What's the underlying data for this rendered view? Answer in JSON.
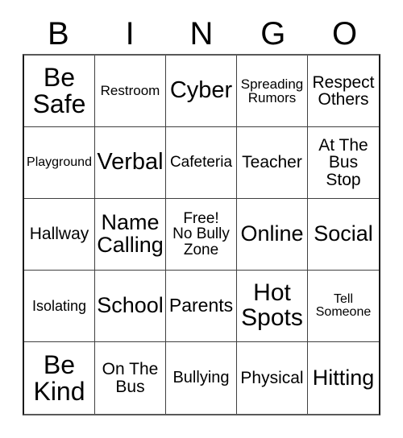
{
  "card": {
    "type": "bingo-card",
    "theme": "Anti-Bullying / School Safety",
    "grid_size": "5x5",
    "free_space_index": 12,
    "text_color": "#000000",
    "background_color": "#ffffff",
    "border_color": "#404040"
  },
  "header": {
    "letters": [
      "B",
      "I",
      "N",
      "G",
      "O"
    ]
  },
  "columns": {
    "B": [
      "Be\nSafe",
      "Playground",
      "Hallway",
      "Isolating",
      "Be\nKind"
    ],
    "I": [
      "Restroom",
      "Verbal",
      "Name\nCalling",
      "School",
      "On The\nBus"
    ],
    "N": [
      "Cyber",
      "Cafeteria",
      "Free!\nNo Bully\nZone",
      "Parents",
      "Bullying"
    ],
    "G": [
      "Spreading\nRumors",
      "Teacher",
      "Online",
      "Hot\nSpots",
      "Physical"
    ],
    "O": [
      "Respect\nOthers",
      "At The\nBus\nStop",
      "Social",
      "Tell\nSomeone",
      "Hitting"
    ]
  },
  "cells": [
    {
      "text": "Be\nSafe",
      "row": 1,
      "col": "B",
      "font_size": 32,
      "free": false
    },
    {
      "text": "Restroom",
      "row": 1,
      "col": "I",
      "font_size": 17,
      "free": false
    },
    {
      "text": "Cyber",
      "row": 1,
      "col": "N",
      "font_size": 29,
      "free": false
    },
    {
      "text": "Spreading\nRumors",
      "row": 1,
      "col": "G",
      "font_size": 17,
      "free": false
    },
    {
      "text": "Respect\nOthers",
      "row": 1,
      "col": "O",
      "font_size": 21,
      "free": false
    },
    {
      "text": "Playground",
      "row": 2,
      "col": "B",
      "font_size": 16,
      "free": false
    },
    {
      "text": "Verbal",
      "row": 2,
      "col": "I",
      "font_size": 29,
      "free": false
    },
    {
      "text": "Cafeteria",
      "row": 2,
      "col": "N",
      "font_size": 19,
      "free": false
    },
    {
      "text": "Teacher",
      "row": 2,
      "col": "G",
      "font_size": 21,
      "free": false
    },
    {
      "text": "At The\nBus\nStop",
      "row": 2,
      "col": "O",
      "font_size": 21,
      "free": false
    },
    {
      "text": "Hallway",
      "row": 3,
      "col": "B",
      "font_size": 21,
      "free": false
    },
    {
      "text": "Name\nCalling",
      "row": 3,
      "col": "I",
      "font_size": 27,
      "free": false
    },
    {
      "text": "Free!\nNo Bully\nZone",
      "row": 3,
      "col": "N",
      "font_size": 19,
      "free": true
    },
    {
      "text": "Online",
      "row": 3,
      "col": "G",
      "font_size": 27,
      "free": false
    },
    {
      "text": "Social",
      "row": 3,
      "col": "O",
      "font_size": 27,
      "free": false
    },
    {
      "text": "Isolating",
      "row": 4,
      "col": "B",
      "font_size": 18,
      "free": false
    },
    {
      "text": "School",
      "row": 4,
      "col": "I",
      "font_size": 27,
      "free": false
    },
    {
      "text": "Parents",
      "row": 4,
      "col": "N",
      "font_size": 23,
      "free": false
    },
    {
      "text": "Hot\nSpots",
      "row": 4,
      "col": "G",
      "font_size": 30,
      "free": false
    },
    {
      "text": "Tell\nSomeone",
      "row": 4,
      "col": "O",
      "font_size": 16,
      "free": false
    },
    {
      "text": "Be\nKind",
      "row": 5,
      "col": "B",
      "font_size": 32,
      "free": false
    },
    {
      "text": "On The\nBus",
      "row": 5,
      "col": "I",
      "font_size": 21,
      "free": false
    },
    {
      "text": "Bullying",
      "row": 5,
      "col": "N",
      "font_size": 20,
      "free": false
    },
    {
      "text": "Physical",
      "row": 5,
      "col": "G",
      "font_size": 21,
      "free": false
    },
    {
      "text": "Hitting",
      "row": 5,
      "col": "O",
      "font_size": 27,
      "free": false
    }
  ]
}
